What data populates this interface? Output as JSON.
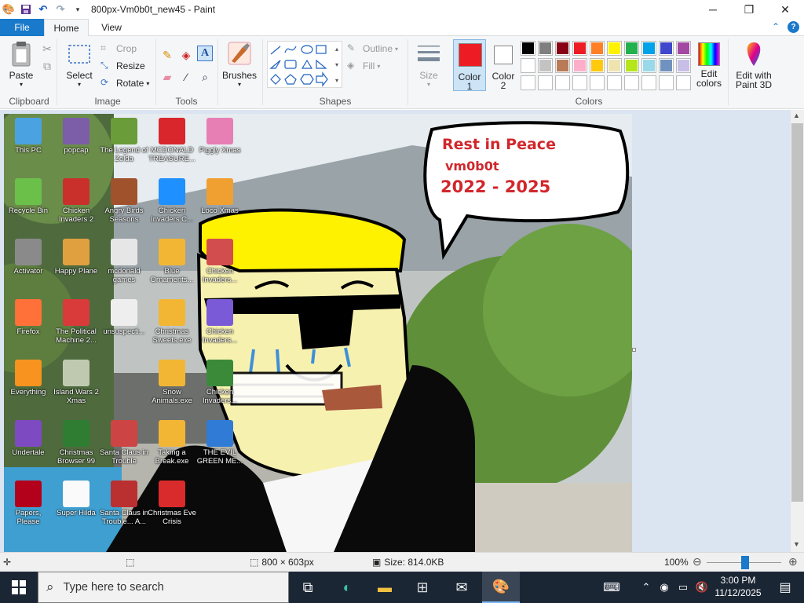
{
  "window": {
    "title": "800px-Vm0b0t_new45 - Paint",
    "minimize": "─",
    "maximize": "❐",
    "close": "✕"
  },
  "tabs": {
    "file": "File",
    "home": "Home",
    "view": "View"
  },
  "ribbon": {
    "clipboard": {
      "paste": "Paste",
      "group": "Clipboard"
    },
    "image": {
      "select": "Select",
      "crop": "Crop",
      "resize": "Resize",
      "rotate": "Rotate",
      "group": "Image"
    },
    "tools": {
      "group": "Tools"
    },
    "brushes": {
      "label": "Brushes"
    },
    "shapes": {
      "outline": "Outline",
      "fill": "Fill",
      "group": "Shapes"
    },
    "size": {
      "label": "Size"
    },
    "colors": {
      "color1": "Color 1",
      "color1_line1": "Color",
      "color1_line2": "1",
      "color2_line1": "Color",
      "color2_line2": "2",
      "edit_line1": "Edit",
      "edit_line2": "colors",
      "paint3d_line1": "Edit with",
      "paint3d_line2": "Paint 3D",
      "group": "Colors",
      "color1_value": "#ed1c24",
      "color2_value": "#ffffff",
      "palette_row1": [
        "#000000",
        "#7f7f7f",
        "#880015",
        "#ed1c24",
        "#ff7f27",
        "#fff200",
        "#22b14c",
        "#00a2e8",
        "#3f48cc",
        "#a349a4"
      ],
      "palette_row2": [
        "#ffffff",
        "#c3c3c3",
        "#b97a57",
        "#ffaec9",
        "#ffc90e",
        "#efe4b0",
        "#b5e61d",
        "#99d9ea",
        "#7092be",
        "#c8bfe7"
      ]
    }
  },
  "desktop_icons": [
    {
      "label": "This PC"
    },
    {
      "label": "popcap"
    },
    {
      "label": "The Legend of Zelda"
    },
    {
      "label": "MCDONALD TREASURE..."
    },
    {
      "label": "Piggly Xmas"
    },
    {
      "label": "Recycle Bin"
    },
    {
      "label": "Chicken Invaders 2"
    },
    {
      "label": "Angry Birds Seasons"
    },
    {
      "label": "Chicken Invaders C..."
    },
    {
      "label": "Loco Xmas"
    },
    {
      "label": "Activator"
    },
    {
      "label": "Happy Plane"
    },
    {
      "label": "mcdonald games"
    },
    {
      "label": "Blue Ornaments..."
    },
    {
      "label": "Chicken Invaders..."
    },
    {
      "label": "Firefox"
    },
    {
      "label": "The Political Machine 2..."
    },
    {
      "label": "unsuspecti..."
    },
    {
      "label": "Christmas Sweets.exe"
    },
    {
      "label": "Chicken Invaders..."
    },
    {
      "label": "Everything"
    },
    {
      "label": "Island Wars 2 Xmas"
    },
    {
      "label": "Snow Animals.exe"
    },
    {
      "label": "Chicken Invaders..."
    },
    {
      "label": "Undertale"
    },
    {
      "label": "Christmas Browser 99"
    },
    {
      "label": "Santa Claus in Trouble"
    },
    {
      "label": "Taking a Break.exe"
    },
    {
      "label": "THE EVIL GREEN ME..."
    },
    {
      "label": "Papers, Please"
    },
    {
      "label": "Super Hilda"
    },
    {
      "label": "Santa Claus in Trouble... A..."
    },
    {
      "label": "Christmas Eve Crisis"
    }
  ],
  "bubble": {
    "line1": "Rest in Peace",
    "line2": "vm0b0t",
    "line3": "2022 - 2025"
  },
  "statusbar": {
    "dimensions": "800 × 603px",
    "size": "Size: 814.0KB",
    "zoom": "100%"
  },
  "taskbar": {
    "search_placeholder": "Type here to search",
    "time": "3:00 PM",
    "date": "11/12/2025"
  }
}
